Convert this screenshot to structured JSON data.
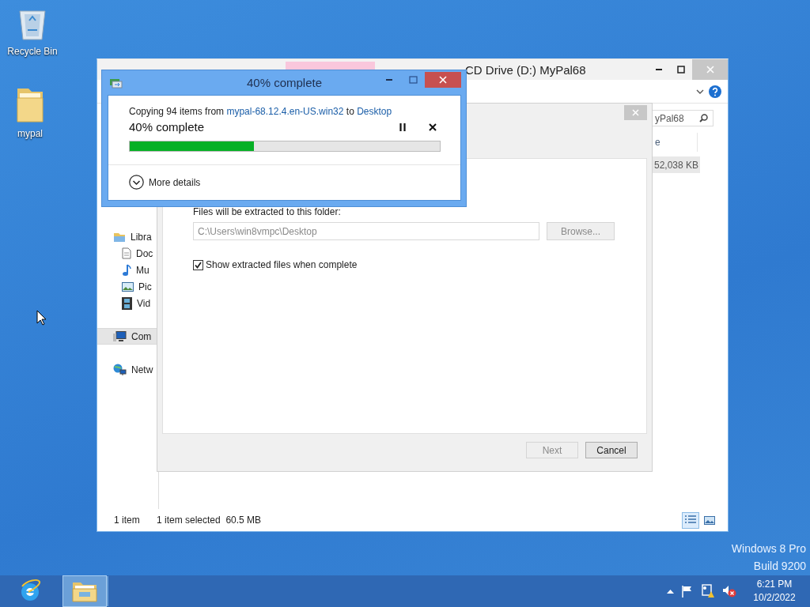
{
  "desktop_icons": [
    {
      "label": "Recycle Bin",
      "kind": "recycle"
    },
    {
      "label": "mypal",
      "kind": "folder"
    }
  ],
  "explorer": {
    "title": "CD Drive (D:) MyPal68",
    "search": {
      "value": "yPal68"
    },
    "column_header": "e",
    "size_cell": "52,038 KB",
    "nav_items": [
      {
        "label": "Libra",
        "kind": "library",
        "selected": false,
        "children": [
          {
            "label": "Doc",
            "kind": "document",
            "selected": false
          },
          {
            "label": "Mu",
            "kind": "music",
            "selected": false
          },
          {
            "label": "Pic",
            "kind": "pictures",
            "selected": false
          },
          {
            "label": "Vid",
            "kind": "videos",
            "selected": false
          }
        ]
      },
      {
        "label": "Com",
        "kind": "computer",
        "selected": true
      },
      {
        "label": "Netw",
        "kind": "network",
        "selected": false
      }
    ],
    "status": [
      "1 item",
      "1 item selected  60.5 MB"
    ],
    "views": [
      {
        "kind": "details",
        "selected": true
      },
      {
        "kind": "thumbnails",
        "selected": false
      }
    ]
  },
  "wizard": {
    "folder_label": "Files will be extracted to this folder:",
    "path": "C:\\Users\\win8vmpc\\Desktop",
    "browse": {
      "label": "Browse...",
      "disabled": true
    },
    "show_files": {
      "label": "Show extracted files when complete",
      "checked": true
    },
    "buttons": [
      {
        "label": "Next",
        "disabled": true
      },
      {
        "label": "Cancel",
        "disabled": false
      }
    ]
  },
  "copy_dialog": {
    "title": "40% complete",
    "message": [
      {
        "kind": "text",
        "text": "Copying 94 items from "
      },
      {
        "kind": "link",
        "text": "mypal-68.12.4.en-US.win32"
      },
      {
        "kind": "text",
        "text": " to "
      },
      {
        "kind": "link",
        "text": "Desktop"
      }
    ],
    "heading": "40% complete",
    "level": 0.4,
    "details": "More details"
  },
  "watermark": [
    "Windows 8 Pro",
    "Build 9200"
  ],
  "taskbar": {
    "apps": [
      {
        "kind": "browser",
        "active": false
      },
      {
        "kind": "explorer",
        "active": true
      }
    ],
    "time": "6:21 PM",
    "date": "10/2/2022"
  }
}
